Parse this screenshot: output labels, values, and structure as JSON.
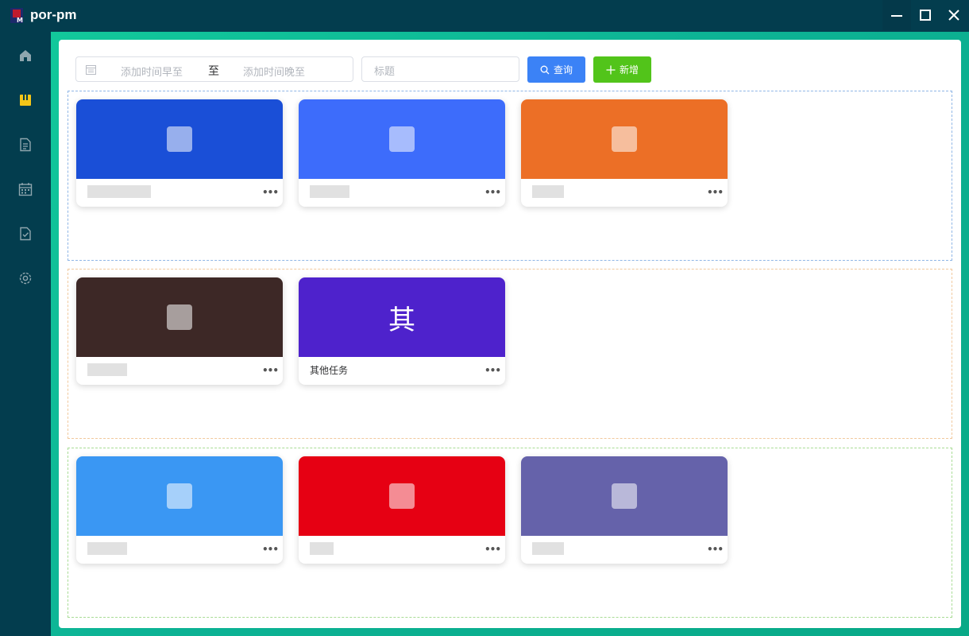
{
  "app": {
    "title": "por-pm"
  },
  "window_controls": {
    "minimize": "—",
    "maximize": "☐",
    "close": "✕"
  },
  "sidebar": {
    "items": [
      {
        "name": "home",
        "icon": "home-icon",
        "active": false
      },
      {
        "name": "projects",
        "icon": "projects-icon",
        "active": true
      },
      {
        "name": "documents",
        "icon": "document-icon",
        "active": false
      },
      {
        "name": "calendar",
        "icon": "calendar-icon",
        "active": false
      },
      {
        "name": "tasks",
        "icon": "task-check-icon",
        "active": false
      },
      {
        "name": "settings",
        "icon": "gear-icon",
        "active": false
      }
    ]
  },
  "filters": {
    "date_start_placeholder": "添加时间早至",
    "date_separator": "至",
    "date_end_placeholder": "添加时间晚至",
    "title_placeholder": "标题",
    "query_label": "查询",
    "add_label": "新增"
  },
  "colors": {
    "frame_accent": "#12c89b",
    "query_button": "#3b82f6",
    "add_button": "#52c41a"
  },
  "groups": [
    {
      "cards": [
        {
          "cover_color": "#1a4fd7",
          "name": ""
        },
        {
          "cover_color": "#3d6cfb",
          "name": ""
        },
        {
          "cover_color": "#ec6f26",
          "name": ""
        }
      ]
    },
    {
      "cards": [
        {
          "cover_color": "#3d2826",
          "name": ""
        },
        {
          "cover_color": "#4e22cc",
          "cover_text": "其",
          "name": "其他任务"
        }
      ]
    },
    {
      "cards": [
        {
          "cover_color": "#3a97f3",
          "name": ""
        },
        {
          "cover_color": "#e60013",
          "name": ""
        },
        {
          "cover_color": "#6562aa",
          "name": ""
        }
      ]
    }
  ],
  "card_more": "•••"
}
